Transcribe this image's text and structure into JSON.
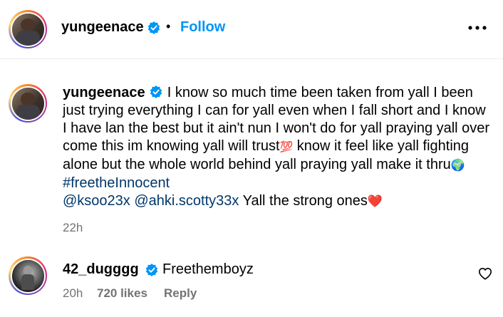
{
  "header": {
    "username": "yungeenace",
    "separator": "•",
    "follow_label": "Follow",
    "more_icon": "more-horizontal-icon"
  },
  "caption": {
    "username": "yungeenace",
    "text_before": "I know so much time been taken from yall I been just trying everything I can for yall even when I fall short and I know I have lan the best but it ain't nun I won't do for yall praying yall over come this im knowing yall will trust",
    "emoji_100": "💯",
    "text_mid": " know it feel like yall fighting alone but the whole world behind yall praying yall make it thru",
    "emoji_globe": "🌍",
    "hashtag": "#freetheInnocent",
    "mention1": "@ksoo23x",
    "mention2": "@ahki.scotty33x",
    "text_end": " Yall the strong ones",
    "emoji_heart": "❤️",
    "time": "22h"
  },
  "comment": {
    "username": "42_dugggg",
    "text": "Freethemboyz",
    "time": "20h",
    "likes": "720 likes",
    "reply_label": "Reply",
    "like_icon": "heart-outline-icon"
  },
  "colors": {
    "verified": "#0095f6",
    "follow": "#0095f6",
    "link": "#00376b",
    "meta": "#737373"
  }
}
